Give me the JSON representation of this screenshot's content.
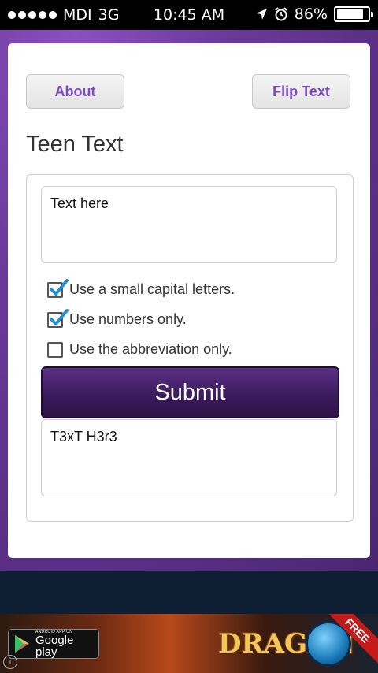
{
  "status_bar": {
    "carrier": "MDI",
    "network": "3G",
    "time": "10:45 AM",
    "battery": "86%",
    "battery_level": 0.86
  },
  "header": {
    "about_label": "About",
    "flip_label": "Flip Text",
    "title": "Teen Text"
  },
  "form": {
    "input_text": "Text here",
    "options": [
      {
        "label": "Use a small capital letters.",
        "checked": true
      },
      {
        "label": "Use numbers only.",
        "checked": true
      },
      {
        "label": "Use the abbreviation only.",
        "checked": false
      }
    ],
    "submit_label": "Submit",
    "output_text": "T3xT H3r3"
  },
  "ad": {
    "badge_small": "ANDROID APP ON",
    "badge_large": "Google play",
    "game_title": "DRAGON",
    "ribbon": "FREE"
  },
  "colors": {
    "accent": "#7c4bc1",
    "submit_bg": "#3a1a5a",
    "checkmark": "#1f8fd6"
  }
}
